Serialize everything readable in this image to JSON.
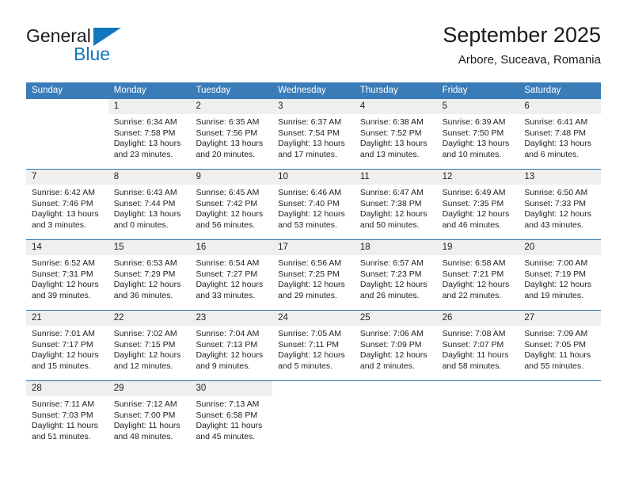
{
  "brand": {
    "name_top": "General",
    "name_bottom": "Blue",
    "accent_color": "#1277bc"
  },
  "header": {
    "title": "September 2025",
    "subtitle": "Arbore, Suceava, Romania"
  },
  "calendar": {
    "header_bg": "#3a7cb8",
    "daynum_bg": "#efefef",
    "separator_color": "#2f6fa8",
    "weekdays": [
      "Sunday",
      "Monday",
      "Tuesday",
      "Wednesday",
      "Thursday",
      "Friday",
      "Saturday"
    ],
    "weeks": [
      [
        {
          "day": "",
          "lines": []
        },
        {
          "day": "1",
          "lines": [
            "Sunrise: 6:34 AM",
            "Sunset: 7:58 PM",
            "Daylight: 13 hours",
            "and 23 minutes."
          ]
        },
        {
          "day": "2",
          "lines": [
            "Sunrise: 6:35 AM",
            "Sunset: 7:56 PM",
            "Daylight: 13 hours",
            "and 20 minutes."
          ]
        },
        {
          "day": "3",
          "lines": [
            "Sunrise: 6:37 AM",
            "Sunset: 7:54 PM",
            "Daylight: 13 hours",
            "and 17 minutes."
          ]
        },
        {
          "day": "4",
          "lines": [
            "Sunrise: 6:38 AM",
            "Sunset: 7:52 PM",
            "Daylight: 13 hours",
            "and 13 minutes."
          ]
        },
        {
          "day": "5",
          "lines": [
            "Sunrise: 6:39 AM",
            "Sunset: 7:50 PM",
            "Daylight: 13 hours",
            "and 10 minutes."
          ]
        },
        {
          "day": "6",
          "lines": [
            "Sunrise: 6:41 AM",
            "Sunset: 7:48 PM",
            "Daylight: 13 hours",
            "and 6 minutes."
          ]
        }
      ],
      [
        {
          "day": "7",
          "lines": [
            "Sunrise: 6:42 AM",
            "Sunset: 7:46 PM",
            "Daylight: 13 hours",
            "and 3 minutes."
          ]
        },
        {
          "day": "8",
          "lines": [
            "Sunrise: 6:43 AM",
            "Sunset: 7:44 PM",
            "Daylight: 13 hours",
            "and 0 minutes."
          ]
        },
        {
          "day": "9",
          "lines": [
            "Sunrise: 6:45 AM",
            "Sunset: 7:42 PM",
            "Daylight: 12 hours",
            "and 56 minutes."
          ]
        },
        {
          "day": "10",
          "lines": [
            "Sunrise: 6:46 AM",
            "Sunset: 7:40 PM",
            "Daylight: 12 hours",
            "and 53 minutes."
          ]
        },
        {
          "day": "11",
          "lines": [
            "Sunrise: 6:47 AM",
            "Sunset: 7:38 PM",
            "Daylight: 12 hours",
            "and 50 minutes."
          ]
        },
        {
          "day": "12",
          "lines": [
            "Sunrise: 6:49 AM",
            "Sunset: 7:35 PM",
            "Daylight: 12 hours",
            "and 46 minutes."
          ]
        },
        {
          "day": "13",
          "lines": [
            "Sunrise: 6:50 AM",
            "Sunset: 7:33 PM",
            "Daylight: 12 hours",
            "and 43 minutes."
          ]
        }
      ],
      [
        {
          "day": "14",
          "lines": [
            "Sunrise: 6:52 AM",
            "Sunset: 7:31 PM",
            "Daylight: 12 hours",
            "and 39 minutes."
          ]
        },
        {
          "day": "15",
          "lines": [
            "Sunrise: 6:53 AM",
            "Sunset: 7:29 PM",
            "Daylight: 12 hours",
            "and 36 minutes."
          ]
        },
        {
          "day": "16",
          "lines": [
            "Sunrise: 6:54 AM",
            "Sunset: 7:27 PM",
            "Daylight: 12 hours",
            "and 33 minutes."
          ]
        },
        {
          "day": "17",
          "lines": [
            "Sunrise: 6:56 AM",
            "Sunset: 7:25 PM",
            "Daylight: 12 hours",
            "and 29 minutes."
          ]
        },
        {
          "day": "18",
          "lines": [
            "Sunrise: 6:57 AM",
            "Sunset: 7:23 PM",
            "Daylight: 12 hours",
            "and 26 minutes."
          ]
        },
        {
          "day": "19",
          "lines": [
            "Sunrise: 6:58 AM",
            "Sunset: 7:21 PM",
            "Daylight: 12 hours",
            "and 22 minutes."
          ]
        },
        {
          "day": "20",
          "lines": [
            "Sunrise: 7:00 AM",
            "Sunset: 7:19 PM",
            "Daylight: 12 hours",
            "and 19 minutes."
          ]
        }
      ],
      [
        {
          "day": "21",
          "lines": [
            "Sunrise: 7:01 AM",
            "Sunset: 7:17 PM",
            "Daylight: 12 hours",
            "and 15 minutes."
          ]
        },
        {
          "day": "22",
          "lines": [
            "Sunrise: 7:02 AM",
            "Sunset: 7:15 PM",
            "Daylight: 12 hours",
            "and 12 minutes."
          ]
        },
        {
          "day": "23",
          "lines": [
            "Sunrise: 7:04 AM",
            "Sunset: 7:13 PM",
            "Daylight: 12 hours",
            "and 9 minutes."
          ]
        },
        {
          "day": "24",
          "lines": [
            "Sunrise: 7:05 AM",
            "Sunset: 7:11 PM",
            "Daylight: 12 hours",
            "and 5 minutes."
          ]
        },
        {
          "day": "25",
          "lines": [
            "Sunrise: 7:06 AM",
            "Sunset: 7:09 PM",
            "Daylight: 12 hours",
            "and 2 minutes."
          ]
        },
        {
          "day": "26",
          "lines": [
            "Sunrise: 7:08 AM",
            "Sunset: 7:07 PM",
            "Daylight: 11 hours",
            "and 58 minutes."
          ]
        },
        {
          "day": "27",
          "lines": [
            "Sunrise: 7:09 AM",
            "Sunset: 7:05 PM",
            "Daylight: 11 hours",
            "and 55 minutes."
          ]
        }
      ],
      [
        {
          "day": "28",
          "lines": [
            "Sunrise: 7:11 AM",
            "Sunset: 7:03 PM",
            "Daylight: 11 hours",
            "and 51 minutes."
          ]
        },
        {
          "day": "29",
          "lines": [
            "Sunrise: 7:12 AM",
            "Sunset: 7:00 PM",
            "Daylight: 11 hours",
            "and 48 minutes."
          ]
        },
        {
          "day": "30",
          "lines": [
            "Sunrise: 7:13 AM",
            "Sunset: 6:58 PM",
            "Daylight: 11 hours",
            "and 45 minutes."
          ]
        },
        {
          "day": "",
          "lines": []
        },
        {
          "day": "",
          "lines": []
        },
        {
          "day": "",
          "lines": []
        },
        {
          "day": "",
          "lines": []
        }
      ]
    ]
  }
}
